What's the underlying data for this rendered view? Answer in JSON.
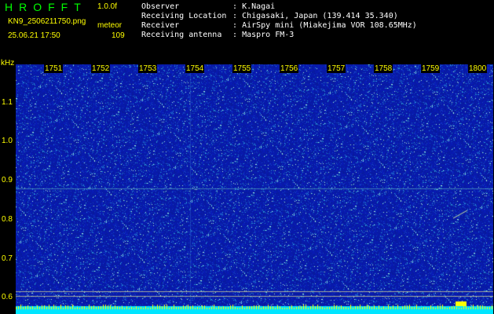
{
  "header": {
    "title": "HROFFT",
    "version": "1.0.0f",
    "filename": "KN9_2506211750.png",
    "mode": "meteor",
    "datetime": "25.06.21 17:50",
    "count": "109"
  },
  "meta": [
    {
      "label": "Observer",
      "sep": ":",
      "value": "K.Nagai"
    },
    {
      "label": "Receiving Location",
      "sep": ":",
      "value": "Chigasaki, Japan (139.414 35.340)"
    },
    {
      "label": "Receiver",
      "sep": ":",
      "value": "AirSpy mini (Miakejima VOR 108.65MHz)"
    },
    {
      "label": "Receiving antenna",
      "sep": ":",
      "value": "Maspro FM-3"
    }
  ],
  "axis": {
    "y_unit": "kHz",
    "y_ticks": [
      "1.1",
      "1.0",
      "0.9",
      "0.8",
      "0.7",
      "0.6"
    ],
    "time_ticks": [
      "1751",
      "1752",
      "1753",
      "1754",
      "1755",
      "1756",
      "1757",
      "1758",
      "1759",
      "1800"
    ]
  },
  "colors": {
    "title": "#00ff00",
    "yellow": "#ffff00",
    "tick_label": "#ffff00",
    "meta_text": "#ffffff",
    "spectrum_bg": "#0b1fa8",
    "bottom_band": "#00e5ff"
  }
}
